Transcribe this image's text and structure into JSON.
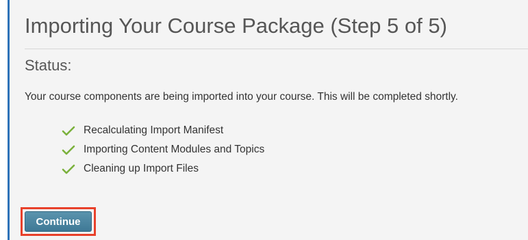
{
  "page": {
    "title": "Importing Your Course Package (Step 5 of 5)",
    "status_heading": "Status:",
    "status_message": "Your course components are being imported into your course. This will be completed shortly."
  },
  "steps": [
    {
      "label": "Recalculating Import Manifest",
      "icon": "check-icon",
      "state": "complete"
    },
    {
      "label": "Importing Content Modules and Topics",
      "icon": "check-icon",
      "state": "complete"
    },
    {
      "label": "Cleaning up Import Files",
      "icon": "check-icon",
      "state": "complete"
    }
  ],
  "actions": {
    "continue_label": "Continue"
  },
  "colors": {
    "accent_border": "#2e73b8",
    "check": "#7bb13c",
    "button": "#4a84a1",
    "highlight": "#e8402a"
  }
}
